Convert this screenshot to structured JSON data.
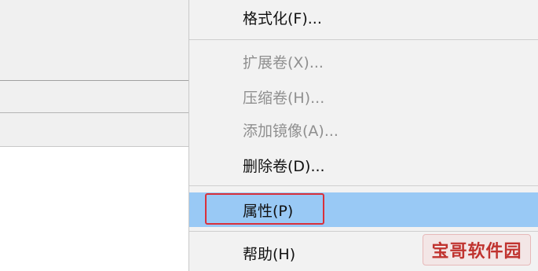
{
  "context_menu": {
    "items": [
      {
        "label": "格式化(F)...",
        "enabled": true
      },
      {
        "label": "扩展卷(X)...",
        "enabled": false
      },
      {
        "label": "压缩卷(H)...",
        "enabled": false
      },
      {
        "label": "添加镜像(A)...",
        "enabled": false
      },
      {
        "label": "删除卷(D)...",
        "enabled": true
      },
      {
        "label": "属性(P)",
        "enabled": true,
        "highlighted": true
      },
      {
        "label": "帮助(H)",
        "enabled": true
      }
    ]
  },
  "watermark": {
    "text": "宝哥软件园"
  },
  "colors": {
    "highlight": "#99c9f5",
    "focus_outline": "#d9303a",
    "menu_background": "#f2f2f2",
    "disabled_text": "#8f8f8f",
    "watermark_text": "#c0332f"
  }
}
